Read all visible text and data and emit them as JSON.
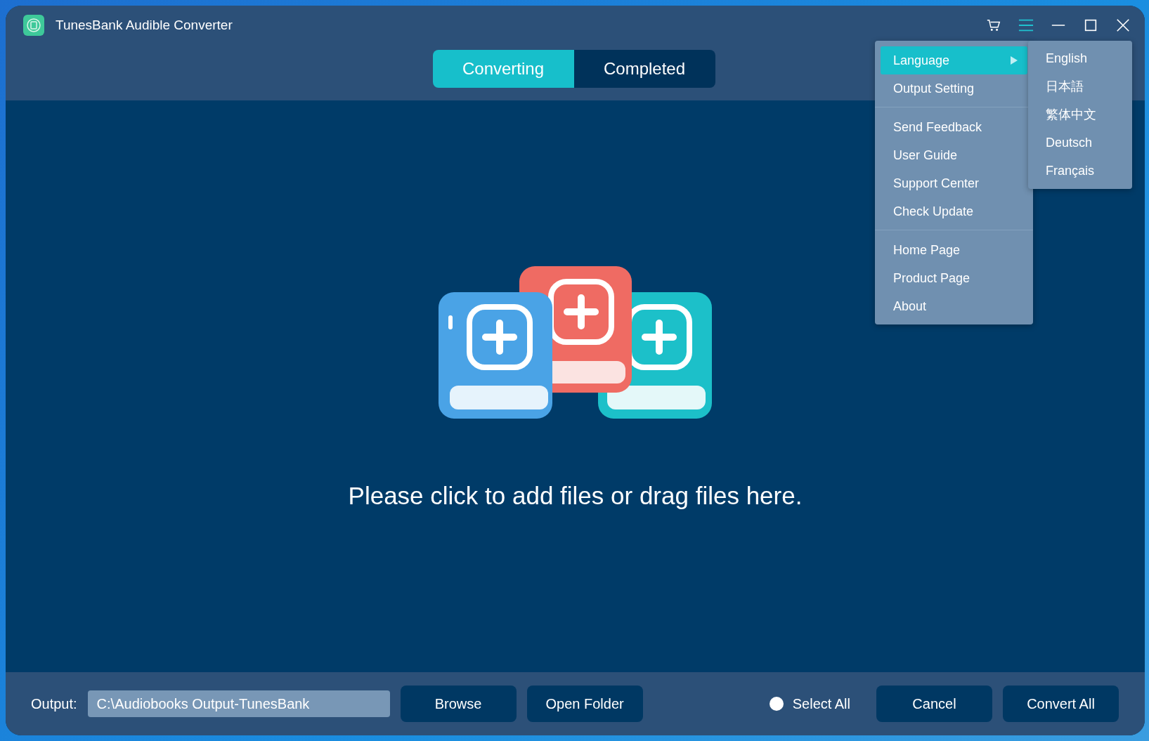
{
  "window": {
    "title": "TunesBank Audible Converter"
  },
  "tabs": [
    {
      "label": "Converting",
      "selected": true
    },
    {
      "label": "Completed",
      "selected": false
    }
  ],
  "drop_area": {
    "message": "Please click to add files or drag files here."
  },
  "menu": {
    "groups": [
      [
        {
          "label": "Language",
          "kind": "submenu",
          "selected": true
        },
        {
          "label": "Output Setting",
          "kind": "item",
          "selected": false
        }
      ],
      [
        {
          "label": "Send Feedback",
          "kind": "item",
          "selected": false
        },
        {
          "label": "User Guide",
          "kind": "item",
          "selected": false
        },
        {
          "label": "Support Center",
          "kind": "item",
          "selected": false
        },
        {
          "label": "Check Update",
          "kind": "item",
          "selected": false
        }
      ],
      [
        {
          "label": "Home Page",
          "kind": "item",
          "selected": false
        },
        {
          "label": "Product Page",
          "kind": "item",
          "selected": false
        },
        {
          "label": "About",
          "kind": "item",
          "selected": false
        }
      ]
    ]
  },
  "language_menu": [
    {
      "label": "English",
      "selected": false
    },
    {
      "label": "日本語",
      "selected": false
    },
    {
      "label": "繁体中文",
      "selected": false
    },
    {
      "label": "Deutsch",
      "selected": false
    },
    {
      "label": "Français",
      "selected": false
    }
  ],
  "bottom_bar": {
    "output_label": "Output:",
    "output_path": "C:\\Audiobooks Output-TunesBank",
    "browse": "Browse",
    "open_folder": "Open Folder",
    "select_all": {
      "label": "Select All",
      "checked": false
    },
    "cancel": "Cancel",
    "convert_all": "Convert All"
  }
}
